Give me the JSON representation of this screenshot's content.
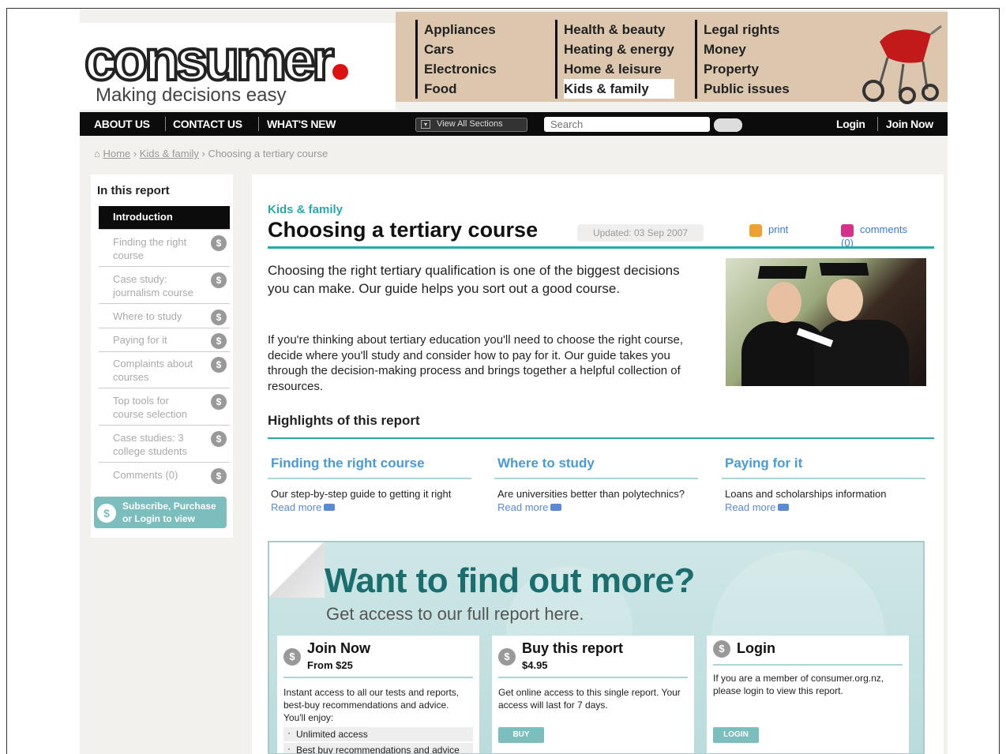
{
  "brand": {
    "name": "consumer",
    "tagline": "Making decisions easy"
  },
  "topnav": {
    "col1": [
      "Appliances",
      "Cars",
      "Electronics",
      "Food"
    ],
    "col2": [
      "Health & beauty",
      "Heating & energy",
      "Home & leisure",
      "Kids & family"
    ],
    "col3": [
      "Legal rights",
      "Money",
      "Property",
      "Public issues"
    ]
  },
  "bar": {
    "about": "ABOUT US",
    "contact": "CONTACT US",
    "whatsnew": "WHAT'S NEW",
    "viewall": "View All Sections",
    "search_placeholder": "Search",
    "login": "Login",
    "join": "Join Now"
  },
  "breadcrumb": {
    "home": "Home",
    "section": "Kids & family",
    "current": "Choosing a tertiary course"
  },
  "sidebar": {
    "heading": "In this report",
    "items": [
      {
        "label": "Introduction"
      },
      {
        "label": "Finding the right course"
      },
      {
        "label": "Case study: journalism course"
      },
      {
        "label": "Where to study"
      },
      {
        "label": "Paying for it"
      },
      {
        "label": "Complaints about courses"
      },
      {
        "label": "Top tools for course selection"
      },
      {
        "label": "Case studies: 3 college students"
      },
      {
        "label": "Comments (0)"
      }
    ],
    "subscribe": "Subscribe, Purchase or Login to view"
  },
  "article": {
    "kicker": "Kids & family",
    "title": "Choosing a tertiary course",
    "updated": "Updated: 03 Sep 2007",
    "print": "print",
    "comments": "comments (0)",
    "intro": "Choosing the right tertiary qualification is one of the biggest decisions you can make. Our guide helps you sort out a good course.",
    "body": "If you're thinking about tertiary education you'll need to choose the right course, decide where you'll study and consider how to pay for it. Our guide takes you through the decision-making process and brings together a helpful collection of resources.",
    "highlights_heading": "Highlights of this report",
    "highlights": [
      {
        "title": "Finding the right course",
        "desc": "Our step-by-step guide to getting it right",
        "link": "Read more"
      },
      {
        "title": "Where to study",
        "desc": "Are universities better than polytechnics?",
        "link": "Read more"
      },
      {
        "title": "Paying for it",
        "desc": "Loans and scholarships information",
        "link": "Read more"
      }
    ]
  },
  "promo": {
    "headline": "Want to find out more?",
    "sub": "Get access to our full report here.",
    "join": {
      "title": "Join Now",
      "price": "From $25",
      "text": "Instant access to all our tests and reports, best-buy recommendations and advice. You'll enjoy:",
      "bullets": [
        "Unlimited access",
        "Best buy recommendations and advice"
      ]
    },
    "buy": {
      "title": "Buy this report",
      "price": "$4.95",
      "text": "Get online access to this single report. Your access will last for 7 days.",
      "button": "BUY"
    },
    "login": {
      "title": "Login",
      "text": "If you are a member of consumer.org.nz, please login to view this report.",
      "button": "LOGIN"
    }
  },
  "colors": {
    "accent": "#2aa8a8",
    "nav_bg": "#dcc7ae",
    "bar_bg": "#0c0c0c",
    "link": "#4a9ad6"
  }
}
